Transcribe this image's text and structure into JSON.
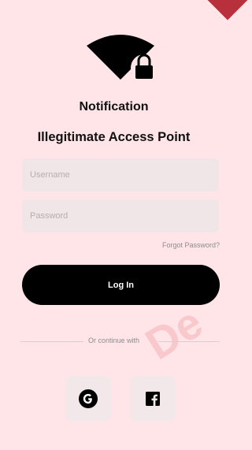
{
  "heading": {
    "title": "Notification",
    "subtitle": "Illegitimate Access Point"
  },
  "form": {
    "username_placeholder": "Username",
    "username_value": "",
    "password_placeholder": "Password",
    "password_value": "",
    "forgot_label": "Forgot Password?",
    "login_label": "Log In"
  },
  "divider": {
    "label": "Or continue with"
  },
  "social": {
    "google_icon": "google-icon",
    "facebook_icon": "facebook-icon"
  },
  "watermark": {
    "text": "De"
  },
  "colors": {
    "background": "#ffe5e8",
    "primary_button": "#000000",
    "input_background": "#f0e6e8",
    "corner_tag": "#b9303d"
  }
}
